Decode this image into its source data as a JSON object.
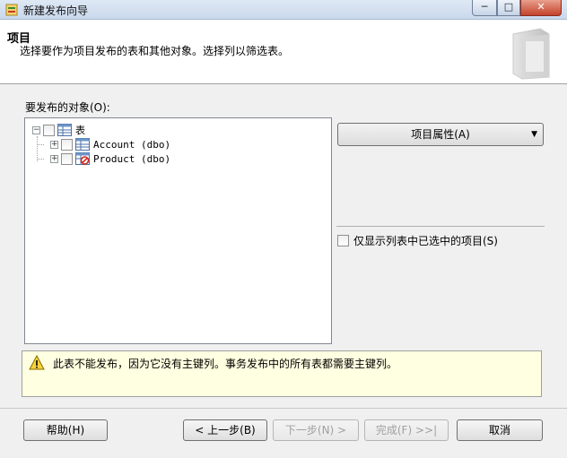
{
  "window": {
    "title": "新建发布向导",
    "minimize_glyph": "─",
    "maximize_glyph": "□",
    "close_glyph": "✕"
  },
  "header": {
    "title": "项目",
    "subtitle": "选择要作为项目发布的表和其他对象。选择列以筛选表。"
  },
  "objects": {
    "label": "要发布的对象(O):",
    "root": {
      "label": "表",
      "expander": "−",
      "icon": "table-icon"
    },
    "items": [
      {
        "label": "Account (dbo)",
        "expander": "+",
        "icon": "table-icon"
      },
      {
        "label": "Product (dbo)",
        "expander": "+",
        "icon": "table-blocked-icon"
      }
    ]
  },
  "props_button": {
    "label": "项目属性(A)",
    "arrow": "▼"
  },
  "filter": {
    "label": "仅显示列表中已选中的项目(S)",
    "checked": false
  },
  "info": {
    "icon": "warning-icon",
    "message": "此表不能发布，因为它没有主键列。事务发布中的所有表都需要主键列。"
  },
  "buttons": {
    "help": "帮助(H)",
    "back": "< 上一步(B)",
    "next": "下一步(N) >",
    "finish": "完成(F) >>|",
    "cancel": "取消"
  },
  "colors": {
    "info_background": "#ffffe1",
    "close_button": "#c4422c"
  }
}
